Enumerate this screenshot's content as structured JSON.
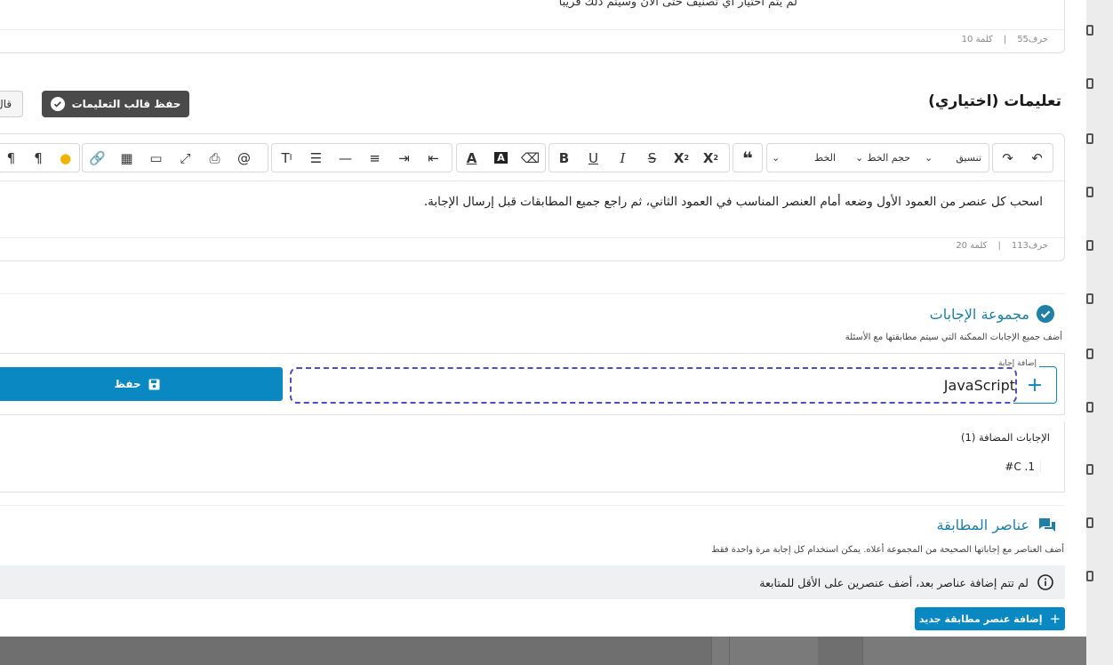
{
  "top_editor": {
    "text": "لم يتم اختيار أي تصنيف حتى الآن وسيتم ذلك قريبا",
    "chars": "حرف55",
    "words": "كلمة 10",
    "sep": "|"
  },
  "instructions": {
    "title": "تعليمات (اختياري)",
    "save_template_label": "حفظ قالب التعليمات",
    "templates_label": "قال",
    "toolbar": {
      "format_label": "تنسيق",
      "font_size_label": "حجم الخط",
      "font_label": "الخط"
    },
    "body_text": "اسحب كل عنصر من العمود الأول وضعه أمام العنصر المناسب في العمود الثاني، ثم راجع جميع المطابقات قبل إرسال الإجابة.",
    "chars": "حرف113",
    "words": "كلمة 20",
    "sep": "|"
  },
  "answers": {
    "title": "مجموعة الإجابات",
    "subtitle": "أضف جميع الإجابات الممكنة التي سيتم مطابقتها مع الأسئلة",
    "input_label": "إضافة إجابة",
    "input_value": "JavaScript",
    "save_label": "حفظ",
    "added_title": "الإجابات المضافة (1)",
    "added_items": [
      "1. C#"
    ]
  },
  "matching": {
    "title": "عناصر المطابقة",
    "subtitle": "أضف العناصر مع إجاباتها الصحيحة من المجموعة أعلاه. يمكن استخدام كل إجابة مرة واحدة فقط",
    "empty_message": "لم تتم إضافة عناصر بعد، أضف عنصرين على الأقل للمتابعة",
    "add_label": "إضافة عنصر مطابقة جديد"
  },
  "colors": {
    "accent": "#0a88c2",
    "section_title": "#1f7fa6",
    "dark_button": "#4a4a4a"
  }
}
